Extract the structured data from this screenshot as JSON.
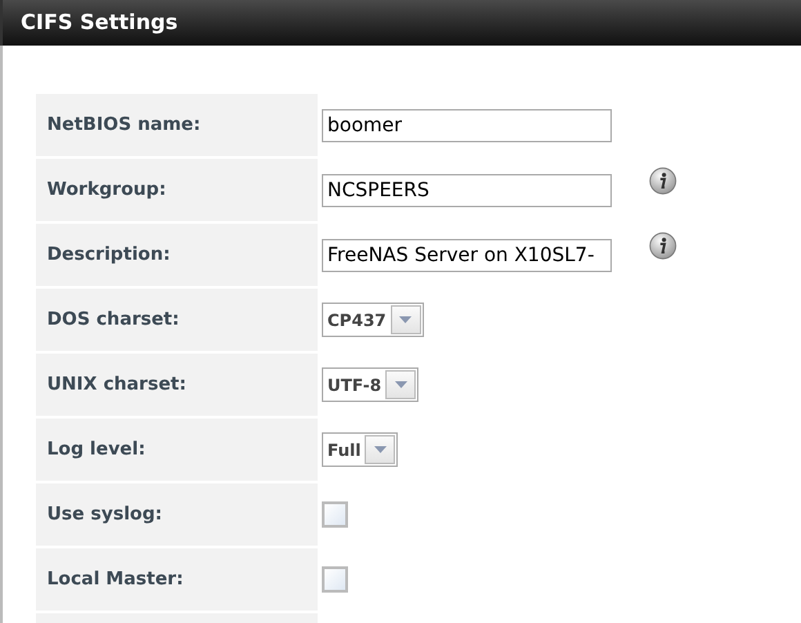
{
  "window": {
    "title": "CIFS Settings"
  },
  "fields": [
    {
      "label": "NetBIOS name:",
      "kind": "text",
      "value": "boomer",
      "info": false
    },
    {
      "label": "Workgroup:",
      "kind": "text",
      "value": "NCSPEERS",
      "info": true
    },
    {
      "label": "Description:",
      "kind": "text",
      "value": "FreeNAS Server on X10SL7-",
      "info": true
    },
    {
      "label": "DOS charset:",
      "kind": "select",
      "value": "CP437",
      "info": false
    },
    {
      "label": "UNIX charset:",
      "kind": "select",
      "value": "UTF-8",
      "info": false
    },
    {
      "label": "Log level:",
      "kind": "select",
      "value": "Full",
      "info": false
    },
    {
      "label": "Use syslog:",
      "kind": "checkbox",
      "checked": false,
      "info": false
    },
    {
      "label": "Local Master:",
      "kind": "checkbox",
      "checked": false,
      "info": false
    }
  ]
}
